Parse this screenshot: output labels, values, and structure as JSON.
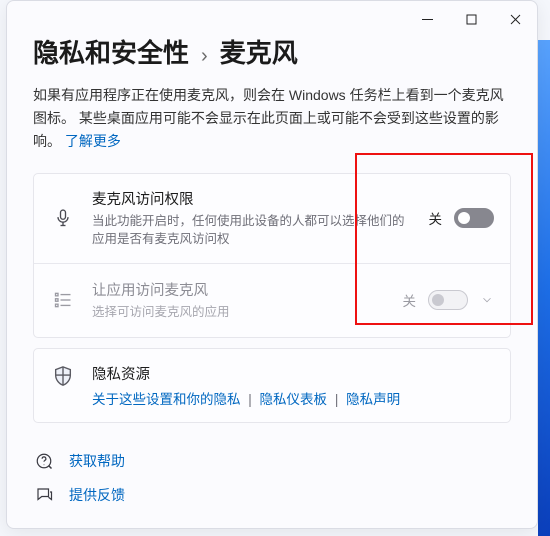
{
  "breadcrumb": {
    "category": "隐私和安全性",
    "separator": "›",
    "page": "麦克风"
  },
  "description": {
    "text_prefix": "如果有应用程序正在使用麦克风，则会在 Windows 任务栏上看到一个麦克风图标。 某些桌面应用可能不会显示在此页面上或可能不会受到这些设置的影响。 ",
    "learn_more": "了解更多"
  },
  "settings": {
    "mic_access": {
      "title": "麦克风访问权限",
      "subtitle": "当此功能开启时，任何使用此设备的人都可以选择他们的应用是否有麦克风访问权",
      "state": "关"
    },
    "apps_access": {
      "title": "让应用访问麦克风",
      "subtitle": "选择可访问麦克风的应用",
      "state": "关"
    }
  },
  "resources": {
    "title": "隐私资源",
    "links": {
      "about": "关于这些设置和你的隐私",
      "dashboard": "隐私仪表板",
      "statement": "隐私声明"
    },
    "sep": "|"
  },
  "footer": {
    "help": "获取帮助",
    "feedback": "提供反馈"
  }
}
